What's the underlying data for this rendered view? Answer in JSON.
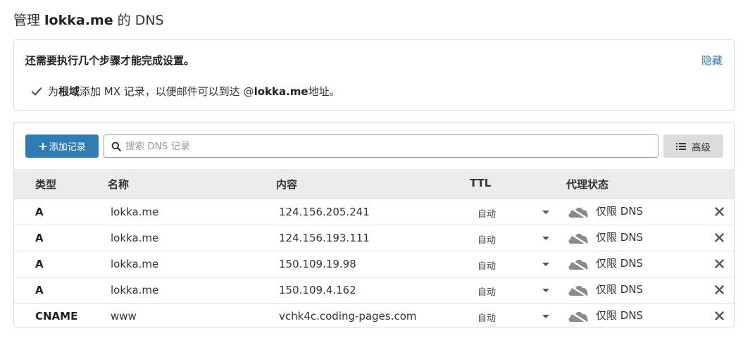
{
  "header": {
    "title_prefix": "管理 ",
    "domain": "lokka.me",
    "title_suffix": " 的 DNS"
  },
  "setup": {
    "title": "还需要执行几个步骤才能完成设置。",
    "hide_label": "隐藏",
    "task": {
      "prefix": "为 ",
      "root": "根域",
      "middle": " 添加 MX 记录，以便邮件可以到达 @",
      "domain": "lokka.me",
      "suffix": " 地址。"
    }
  },
  "toolbar": {
    "add_label": "添加记录",
    "search_placeholder": "搜索 DNS 记录",
    "advanced_label": "高级"
  },
  "table": {
    "headers": {
      "type": "类型",
      "name": "名称",
      "content": "内容",
      "ttl": "TTL",
      "proxy": "代理状态"
    },
    "rows": [
      {
        "type": "A",
        "name": "lokka.me",
        "content": "124.156.205.241",
        "ttl": "自动",
        "proxy": "仅限 DNS"
      },
      {
        "type": "A",
        "name": "lokka.me",
        "content": "124.156.193.111",
        "ttl": "自动",
        "proxy": "仅限 DNS"
      },
      {
        "type": "A",
        "name": "lokka.me",
        "content": "150.109.19.98",
        "ttl": "自动",
        "proxy": "仅限 DNS"
      },
      {
        "type": "A",
        "name": "lokka.me",
        "content": "150.109.4.162",
        "ttl": "自动",
        "proxy": "仅限 DNS"
      },
      {
        "type": "CNAME",
        "name": "www",
        "content": "vchk4c.coding-pages.com",
        "ttl": "自动",
        "proxy": "仅限 DNS"
      }
    ]
  },
  "icons": {
    "check": "check-icon",
    "search": "search-icon",
    "advanced": "list-icon",
    "caret": "caret-down-icon",
    "cloud": "cloud-icon",
    "delete": "close-icon"
  },
  "colors": {
    "primary": "#2f7db5",
    "link": "#2c7cb0",
    "header_bg": "#ececec",
    "cloud": "#8a8a8a"
  }
}
